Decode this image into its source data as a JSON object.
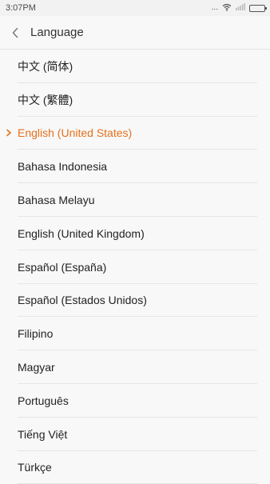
{
  "status_bar": {
    "time": "3:07PM",
    "dots": "...",
    "icons": [
      "wifi-icon",
      "signal-icon",
      "battery-icon"
    ],
    "battery_level": 1.0
  },
  "header": {
    "title": "Language",
    "back_icon": "chevron-left-icon"
  },
  "accent_color": "#e6711c",
  "languages": [
    {
      "label": "中文 (简体)",
      "selected": false
    },
    {
      "label": "中文 (繁體)",
      "selected": false
    },
    {
      "label": "English (United States)",
      "selected": true
    },
    {
      "label": "Bahasa Indonesia",
      "selected": false
    },
    {
      "label": "Bahasa Melayu",
      "selected": false
    },
    {
      "label": "English (United Kingdom)",
      "selected": false
    },
    {
      "label": "Español (España)",
      "selected": false
    },
    {
      "label": "Español (Estados Unidos)",
      "selected": false
    },
    {
      "label": "Filipino",
      "selected": false
    },
    {
      "label": "Magyar",
      "selected": false
    },
    {
      "label": "Português",
      "selected": false
    },
    {
      "label": "Tiếng Việt",
      "selected": false
    },
    {
      "label": "Türkçe",
      "selected": false
    }
  ]
}
